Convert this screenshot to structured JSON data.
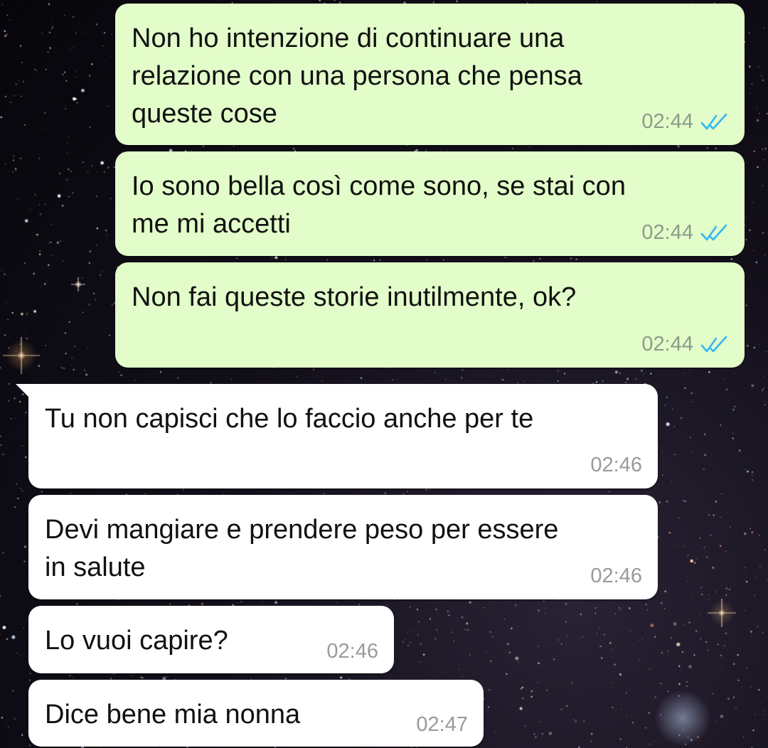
{
  "conversation": {
    "messages": [
      {
        "direction": "outgoing",
        "text": "Non ho intenzione di continuare una\nrelazione con una persona che pensa\nqueste cose",
        "time": "02:44",
        "status_icon": "double-check-read-icon"
      },
      {
        "direction": "outgoing",
        "text": "Io sono bella così come sono, se stai con\nme mi accetti",
        "time": "02:44",
        "status_icon": "double-check-read-icon"
      },
      {
        "direction": "outgoing",
        "text": "Non fai queste storie inutilmente, ok?",
        "time": "02:44",
        "status_icon": "double-check-read-icon"
      },
      {
        "direction": "incoming",
        "text": "Tu non capisci che lo faccio anche per te",
        "time": "02:46"
      },
      {
        "direction": "incoming",
        "text": "Devi mangiare e prendere peso per essere\nin salute",
        "time": "02:46"
      },
      {
        "direction": "incoming",
        "text": "Lo vuoi capire?",
        "time": "02:46"
      },
      {
        "direction": "incoming",
        "text": "Dice bene mia nonna",
        "time": "02:47"
      }
    ]
  },
  "colors": {
    "outgoing_bubble": "#e2fdc9",
    "incoming_bubble": "#ffffff",
    "read_tick": "#34b7f1",
    "timestamp": "#8e9a8a",
    "wallpaper": "#07060b"
  }
}
